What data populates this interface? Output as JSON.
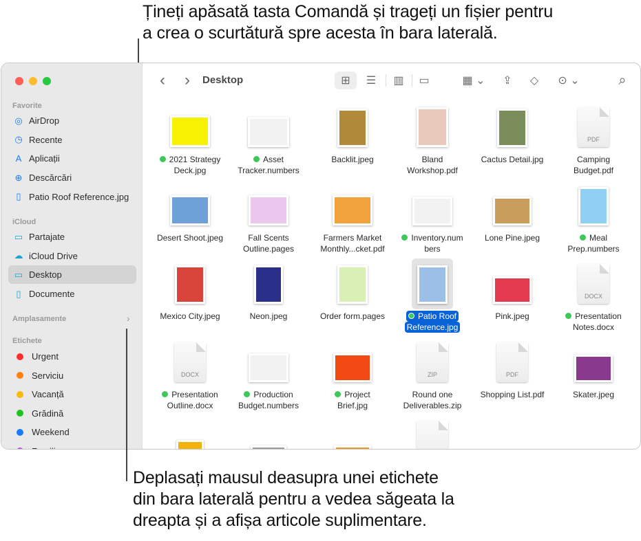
{
  "callouts": {
    "top": "Țineți apăsată tasta Comandă și trageți un fișier pentru\na crea o scurtătură spre acesta în bara laterală.",
    "bottom": "Deplasați mausul deasupra unei etichete\ndin bara laterală pentru a vedea săgeata la\ndreapta și a afișa articole suplimentare."
  },
  "window": {
    "traffic_colors": [
      "#fe5f57",
      "#febc2e",
      "#28c840"
    ]
  },
  "sidebar": {
    "favorites_title": "Favorite",
    "favorites": [
      {
        "label": "AirDrop",
        "icon": "airdrop-icon",
        "glyph": "◎"
      },
      {
        "label": "Recente",
        "icon": "clock-icon",
        "glyph": "◷"
      },
      {
        "label": "Aplicații",
        "icon": "applications-icon",
        "glyph": "A"
      },
      {
        "label": "Descărcări",
        "icon": "download-icon",
        "glyph": "⊕"
      },
      {
        "label": "Patio Roof Reference.jpg",
        "icon": "document-icon",
        "glyph": "▯"
      }
    ],
    "icloud_title": "iCloud",
    "icloud": [
      {
        "label": "Partajate",
        "icon": "shared-folder-icon",
        "glyph": "▭"
      },
      {
        "label": "iCloud Drive",
        "icon": "cloud-icon",
        "glyph": "☁"
      },
      {
        "label": "Desktop",
        "icon": "desktop-icon",
        "glyph": "▭",
        "active": true
      },
      {
        "label": "Documente",
        "icon": "document-icon",
        "glyph": "▯"
      }
    ],
    "locations_title": "Amplasamente",
    "tags_title": "Etichete",
    "tags": [
      {
        "label": "Urgent",
        "color": "#ff2d2d"
      },
      {
        "label": "Serviciu",
        "color": "#ff7f0f"
      },
      {
        "label": "Vacanță",
        "color": "#f7bb0e"
      },
      {
        "label": "Grădină",
        "color": "#1ec31e"
      },
      {
        "label": "Weekend",
        "color": "#1a7cf7"
      },
      {
        "label": "Familie",
        "color": "#b458e2"
      }
    ]
  },
  "toolbar": {
    "title": "Desktop",
    "back": "‹",
    "forward": "›",
    "view_icons": "⊞",
    "view_list": "☰",
    "view_columns": "▥",
    "view_gallery": "▭",
    "group": "▦ ⌄",
    "share": "⇪",
    "tag": "◇",
    "more": "⊙ ⌄",
    "search": "⌕"
  },
  "files": [
    {
      "name": "2021 Strategy\nDeck.jpg",
      "tag": true,
      "thumb": "#f7f200",
      "kind": "image",
      "w": 58,
      "h": 46
    },
    {
      "name": "Asset\nTracker.numbers",
      "tag": true,
      "thumb": "#f2f2f2",
      "kind": "image",
      "w": 60,
      "h": 44
    },
    {
      "name": "Backlit.jpeg",
      "tag": false,
      "thumb": "#b08a3a",
      "kind": "image",
      "w": 44,
      "h": 56
    },
    {
      "name": "Bland\nWorkshop.pdf",
      "tag": false,
      "thumb": "#e9c9bc",
      "kind": "image",
      "w": 46,
      "h": 58
    },
    {
      "name": "Cactus Detail.jpg",
      "tag": false,
      "thumb": "#7a8c5a",
      "kind": "image",
      "w": 44,
      "h": 56
    },
    {
      "name": "Camping\nBudget.pdf",
      "tag": false,
      "thumb": "",
      "kind": "doc",
      "label": "PDF"
    },
    {
      "name": "Desert Shoot.jpeg",
      "tag": false,
      "thumb": "#6ea1d8",
      "kind": "image",
      "w": 58,
      "h": 44
    },
    {
      "name": "Fall Scents\nOutline.pages",
      "tag": false,
      "thumb": "#ebc7ee",
      "kind": "image",
      "w": 58,
      "h": 44
    },
    {
      "name": "Farmers Market\nMonthly...cket.pdf",
      "tag": false,
      "thumb": "#f2a23a",
      "kind": "image",
      "w": 58,
      "h": 44
    },
    {
      "name": "Inventory.num\nbers",
      "tag": true,
      "thumb": "#f2f2f2",
      "kind": "image",
      "w": 58,
      "h": 42
    },
    {
      "name": "Lone Pine.jpeg",
      "tag": false,
      "thumb": "#c99e5c",
      "kind": "image",
      "w": 56,
      "h": 42
    },
    {
      "name": "Meal\nPrep.numbers",
      "tag": true,
      "thumb": "#8fd0f4",
      "kind": "image",
      "w": 44,
      "h": 56
    },
    {
      "name": "Mexico City.jpeg",
      "tag": false,
      "thumb": "#d8433a",
      "kind": "image",
      "w": 44,
      "h": 56
    },
    {
      "name": "Neon.jpeg",
      "tag": false,
      "thumb": "#2a2f8a",
      "kind": "image",
      "w": 42,
      "h": 56
    },
    {
      "name": "Order form.pages",
      "tag": false,
      "thumb": "#d9efb4",
      "kind": "image",
      "w": 44,
      "h": 56
    },
    {
      "name": "Patio Roof\nReference.jpg",
      "tag": true,
      "thumb": "#9cbfe5",
      "kind": "image",
      "w": 44,
      "h": 56,
      "selected": true
    },
    {
      "name": "Pink.jpeg",
      "tag": false,
      "thumb": "#e23a4e",
      "kind": "image",
      "w": 56,
      "h": 40
    },
    {
      "name": "Presentation\nNotes.docx",
      "tag": true,
      "thumb": "",
      "kind": "doc",
      "label": "DOCX"
    },
    {
      "name": "Presentation\nOutline.docx",
      "tag": true,
      "thumb": "",
      "kind": "doc",
      "label": "DOCX"
    },
    {
      "name": "Production\nBudget.numbers",
      "tag": true,
      "thumb": "#f2f2f2",
      "kind": "image",
      "w": 58,
      "h": 42
    },
    {
      "name": "Project\nBrief.jpg",
      "tag": true,
      "thumb": "#f04a12",
      "kind": "image",
      "w": 56,
      "h": 42
    },
    {
      "name": "Round one\nDeliverables.zip",
      "tag": false,
      "thumb": "",
      "kind": "doc",
      "label": "ZIP"
    },
    {
      "name": "Shopping List.pdf",
      "tag": false,
      "thumb": "",
      "kind": "doc",
      "label": "PDF"
    },
    {
      "name": "Skater.jpeg",
      "tag": false,
      "thumb": "#8a3a8e",
      "kind": "image",
      "w": 56,
      "h": 40
    },
    {
      "name": "",
      "tag": false,
      "thumb": "#f2b40c",
      "kind": "image",
      "w": 40,
      "h": 30
    },
    {
      "name": "",
      "tag": false,
      "thumb": "#9a9a9a",
      "kind": "image",
      "w": 52,
      "h": 22
    },
    {
      "name": "",
      "tag": false,
      "thumb": "#e59a1f",
      "kind": "image",
      "w": 54,
      "h": 22
    },
    {
      "name": "",
      "tag": false,
      "thumb": "",
      "kind": "doc",
      "label": ""
    }
  ]
}
